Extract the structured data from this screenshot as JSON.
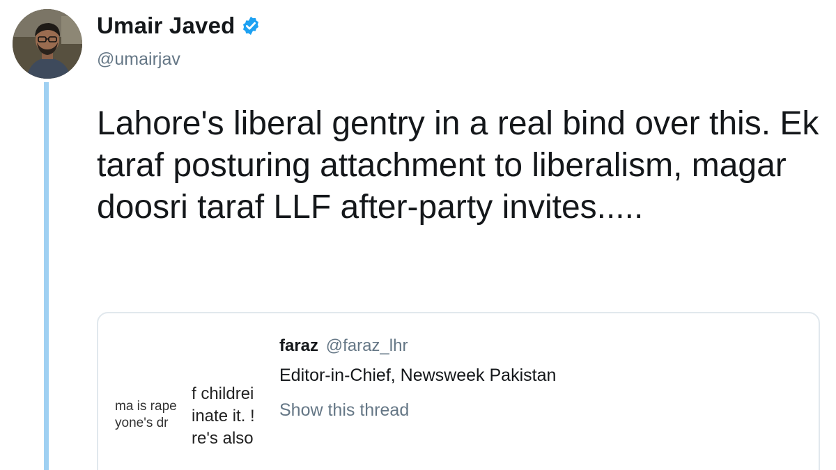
{
  "tweet": {
    "author": {
      "display_name": "Umair Javed",
      "handle": "@umairjav",
      "verified": true,
      "verified_icon": "verified-badge-icon",
      "verified_color": "#1da1f2"
    },
    "text": "Lahore's liberal gentry in a real bind over this. Ek taraf posturing attachment to liberalism, magar doosri taraf LLF after-party invites.....",
    "thread_line_color": "#9fd0f2"
  },
  "quoted_tweet": {
    "name": "faraz",
    "handle": "@faraz_lhr",
    "bio": "Editor-in-Chief, Newsweek Pakistan",
    "show_thread_label": "Show this thread",
    "thumbnail_text": {
      "left_lines": [
        "ma is rape",
        "yone's dr"
      ],
      "right_lines": [
        "f childrei",
        "inate it. !",
        "re's also"
      ]
    }
  }
}
